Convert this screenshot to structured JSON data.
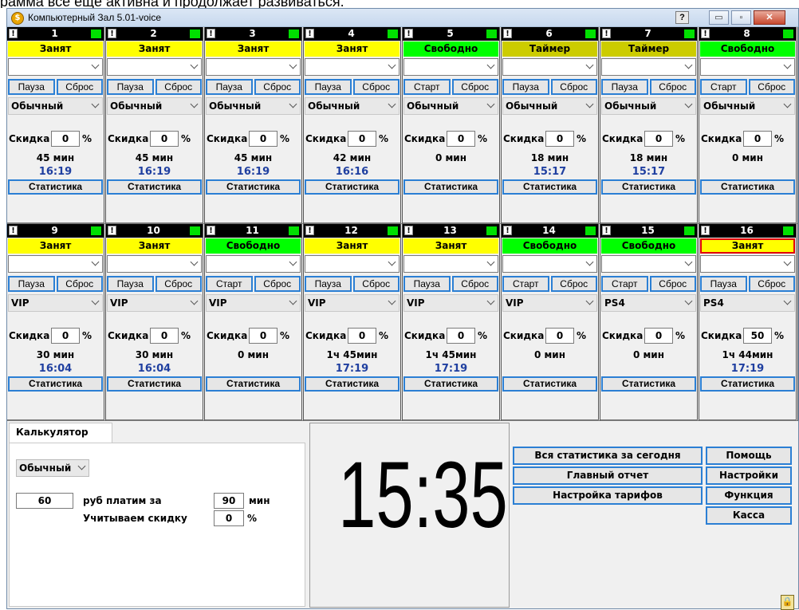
{
  "header_text": "рамма всё ещё активна и продолжает развиваться.",
  "window": {
    "title": "Компьютерный Зал 5.01-voice",
    "help_label": "?",
    "minimize_label": "▭",
    "maximize_label": "▫",
    "close_label": "✕"
  },
  "colors": {
    "busy": "#ffff00",
    "free": "#00ff00",
    "timer": "#cccc00",
    "alarm_border": "#e00000",
    "button_border": "#2b7fd4",
    "end_time": "#1f3fa0"
  },
  "stations": [
    {
      "num": "1",
      "status": "Занят",
      "state": "busy",
      "btn1": "Пауза",
      "btn2": "Сброс",
      "tariff": "Обычный",
      "discount_label": "Скидка",
      "discount": "0",
      "pct": "%",
      "time_left": "45 мин",
      "end_time": "16:19",
      "stats_label": "Статистика"
    },
    {
      "num": "2",
      "status": "Занят",
      "state": "busy",
      "btn1": "Пауза",
      "btn2": "Сброс",
      "tariff": "Обычный",
      "discount_label": "Скидка",
      "discount": "0",
      "pct": "%",
      "time_left": "45 мин",
      "end_time": "16:19",
      "stats_label": "Статистика"
    },
    {
      "num": "3",
      "status": "Занят",
      "state": "busy",
      "btn1": "Пауза",
      "btn2": "Сброс",
      "tariff": "Обычный",
      "discount_label": "Скидка",
      "discount": "0",
      "pct": "%",
      "time_left": "45 мин",
      "end_time": "16:19",
      "stats_label": "Статистика"
    },
    {
      "num": "4",
      "status": "Занят",
      "state": "busy",
      "btn1": "Пауза",
      "btn2": "Сброс",
      "tariff": "Обычный",
      "discount_label": "Скидка",
      "discount": "0",
      "pct": "%",
      "time_left": "42 мин",
      "end_time": "16:16",
      "stats_label": "Статистика"
    },
    {
      "num": "5",
      "status": "Свободно",
      "state": "free",
      "btn1": "Старт",
      "btn2": "Сброс",
      "tariff": "Обычный",
      "discount_label": "Скидка",
      "discount": "0",
      "pct": "%",
      "time_left": "0 мин",
      "end_time": "",
      "stats_label": "Статистика"
    },
    {
      "num": "6",
      "status": "Таймер",
      "state": "timer",
      "btn1": "Пауза",
      "btn2": "Сброс",
      "tariff": "Обычный",
      "discount_label": "Скидка",
      "discount": "0",
      "pct": "%",
      "time_left": "18 мин",
      "end_time": "15:17",
      "stats_label": "Статистика"
    },
    {
      "num": "7",
      "status": "Таймер",
      "state": "timer",
      "btn1": "Пауза",
      "btn2": "Сброс",
      "tariff": "Обычный",
      "discount_label": "Скидка",
      "discount": "0",
      "pct": "%",
      "time_left": "18 мин",
      "end_time": "15:17",
      "stats_label": "Статистика"
    },
    {
      "num": "8",
      "status": "Свободно",
      "state": "free",
      "btn1": "Старт",
      "btn2": "Сброс",
      "tariff": "Обычный",
      "discount_label": "Скидка",
      "discount": "0",
      "pct": "%",
      "time_left": "0 мин",
      "end_time": "",
      "stats_label": "Статистика"
    },
    {
      "num": "9",
      "status": "Занят",
      "state": "busy",
      "btn1": "Пауза",
      "btn2": "Сброс",
      "tariff": "VIP",
      "discount_label": "Скидка",
      "discount": "0",
      "pct": "%",
      "time_left": "30 мин",
      "end_time": "16:04",
      "stats_label": "Статистика"
    },
    {
      "num": "10",
      "status": "Занят",
      "state": "busy",
      "btn1": "Пауза",
      "btn2": "Сброс",
      "tariff": "VIP",
      "discount_label": "Скидка",
      "discount": "0",
      "pct": "%",
      "time_left": "30 мин",
      "end_time": "16:04",
      "stats_label": "Статистика"
    },
    {
      "num": "11",
      "status": "Свободно",
      "state": "free",
      "btn1": "Старт",
      "btn2": "Сброс",
      "tariff": "VIP",
      "discount_label": "Скидка",
      "discount": "0",
      "pct": "%",
      "time_left": "0 мин",
      "end_time": "",
      "stats_label": "Статистика"
    },
    {
      "num": "12",
      "status": "Занят",
      "state": "busy",
      "btn1": "Пауза",
      "btn2": "Сброс",
      "tariff": "VIP",
      "discount_label": "Скидка",
      "discount": "0",
      "pct": "%",
      "time_left": "1ч 45мин",
      "end_time": "17:19",
      "stats_label": "Статистика"
    },
    {
      "num": "13",
      "status": "Занят",
      "state": "busy",
      "btn1": "Пауза",
      "btn2": "Сброс",
      "tariff": "VIP",
      "discount_label": "Скидка",
      "discount": "0",
      "pct": "%",
      "time_left": "1ч 45мин",
      "end_time": "17:19",
      "stats_label": "Статистика"
    },
    {
      "num": "14",
      "status": "Свободно",
      "state": "free",
      "btn1": "Старт",
      "btn2": "Сброс",
      "tariff": "VIP",
      "discount_label": "Скидка",
      "discount": "0",
      "pct": "%",
      "time_left": "0 мин",
      "end_time": "",
      "stats_label": "Статистика"
    },
    {
      "num": "15",
      "status": "Свободно",
      "state": "free",
      "btn1": "Старт",
      "btn2": "Сброс",
      "tariff": "PS4",
      "discount_label": "Скидка",
      "discount": "0",
      "pct": "%",
      "time_left": "0 мин",
      "end_time": "",
      "stats_label": "Статистика"
    },
    {
      "num": "16",
      "status": "Занят",
      "state": "busy",
      "alarm": true,
      "btn1": "Пауза",
      "btn2": "Сброс",
      "tariff": "PS4",
      "discount_label": "Скидка",
      "discount": "50",
      "pct": "%",
      "time_left": "1ч 44мин",
      "end_time": "17:19",
      "stats_label": "Статистика"
    }
  ],
  "calculator": {
    "tab_label": "Калькулятор",
    "tariff": "Обычный",
    "amount": "60",
    "pay_for_label": "руб платим за",
    "minutes": "90",
    "minutes_unit": "мин",
    "discount_label": "Учитываем скидку",
    "discount": "0",
    "pct": "%"
  },
  "clock": {
    "time": "15:35"
  },
  "actions": {
    "today_stats": "Вся статистика за сегодня",
    "main_report": "Главный отчет",
    "tariff_settings": "Настройка тарифов",
    "help": "Помощь",
    "settings": "Настройки",
    "function": "Функция",
    "cashbox": "Касса"
  },
  "lock_icon": "lock-icon"
}
